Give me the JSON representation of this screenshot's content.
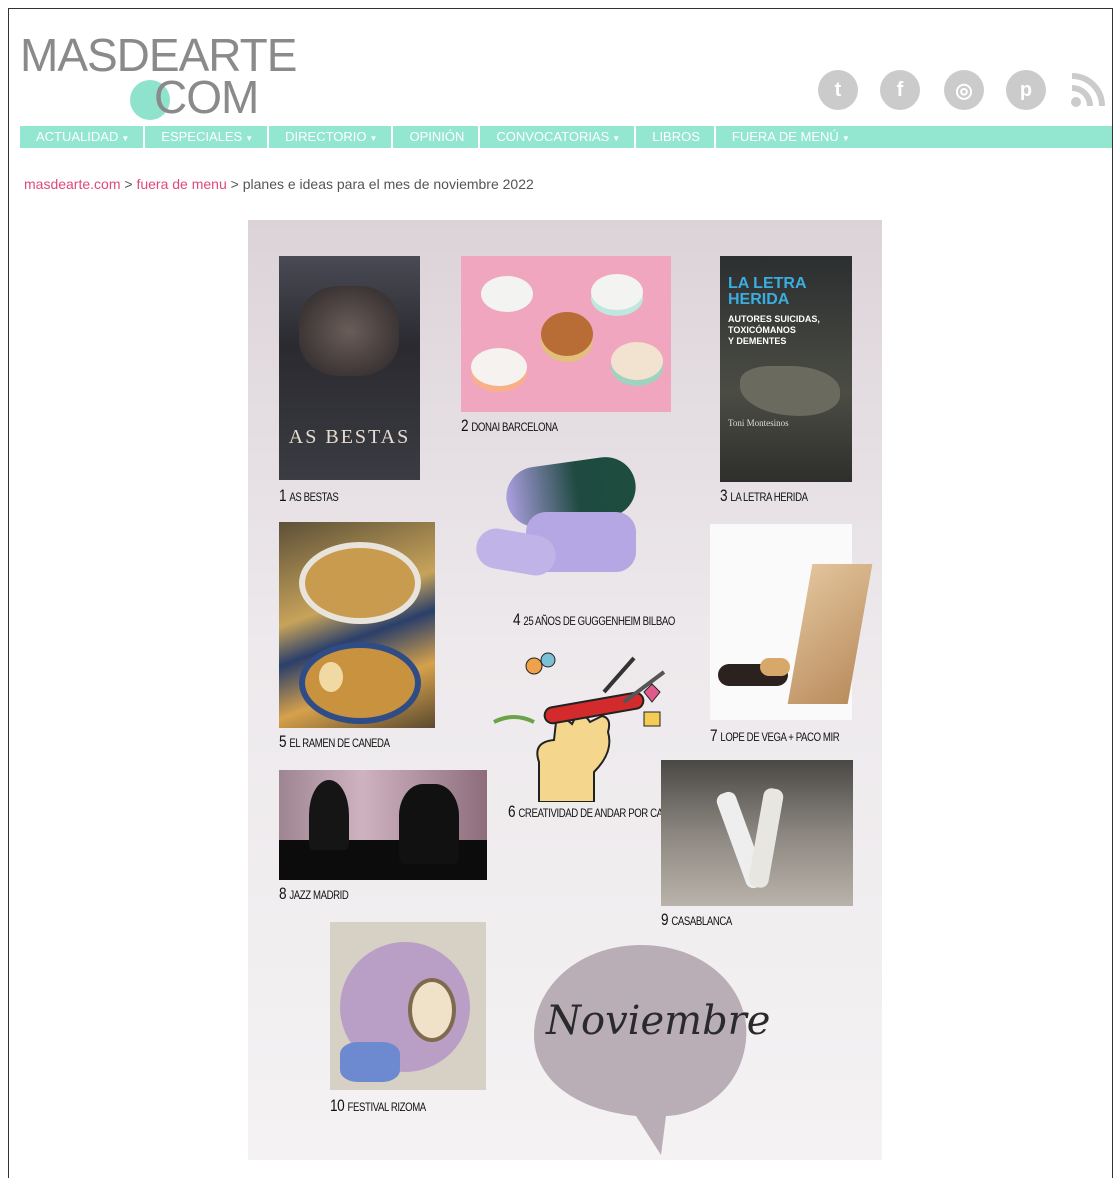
{
  "logo": {
    "line1": "MASDEARTE",
    "line2": "COM"
  },
  "social": [
    {
      "icon": "twitter-icon",
      "glyph": "t"
    },
    {
      "icon": "facebook-icon",
      "glyph": "f"
    },
    {
      "icon": "instagram-icon",
      "glyph": "◎"
    },
    {
      "icon": "pinterest-icon",
      "glyph": "p"
    }
  ],
  "nav": [
    {
      "label": "ACTUALIDAD",
      "caret": true
    },
    {
      "label": "ESPECIALES",
      "caret": true
    },
    {
      "label": "DIRECTORIO",
      "caret": true
    },
    {
      "label": "OPINIÓN",
      "caret": false
    },
    {
      "label": "CONVOCATORIAS",
      "caret": true
    },
    {
      "label": "LIBROS",
      "caret": false
    },
    {
      "label": "FUERA DE MENÚ",
      "caret": true
    }
  ],
  "breadcrumb": {
    "home": "masdearte.com",
    "sep1": " > ",
    "section": "fuera de menu",
    "sep2": " > ",
    "current": "planes e ideas para el mes de noviembre 2022"
  },
  "poster": {
    "items": [
      {
        "num": "1",
        "label": "AS BESTAS"
      },
      {
        "num": "2",
        "label": "DONAI BARCELONA"
      },
      {
        "num": "3",
        "label": "LA LETRA HERIDA"
      },
      {
        "num": "4",
        "label": "25 AÑOS DE GUGGENHEIM BILBAO"
      },
      {
        "num": "5",
        "label": "EL RAMEN DE CANEDA"
      },
      {
        "num": "6",
        "label": "CREATIVIDAD DE ANDAR POR CASA"
      },
      {
        "num": "7",
        "label": "LOPE DE VEGA + PACO MIR"
      },
      {
        "num": "8",
        "label": "JAZZ MADRID"
      },
      {
        "num": "9",
        "label": "CASABLANCA"
      },
      {
        "num": "10",
        "label": "FESTIVAL RIZOMA"
      }
    ],
    "bestas_title": "AS BESTAS",
    "book": {
      "title1": "LA LETRA",
      "title2": "HERIDA",
      "sub1": "AUTORES SUICIDAS,",
      "sub2": "TOXICÓMANOS",
      "sub3": "Y DEMENTES",
      "author": "Toni Montesinos"
    },
    "bubble": "Noviembre"
  }
}
